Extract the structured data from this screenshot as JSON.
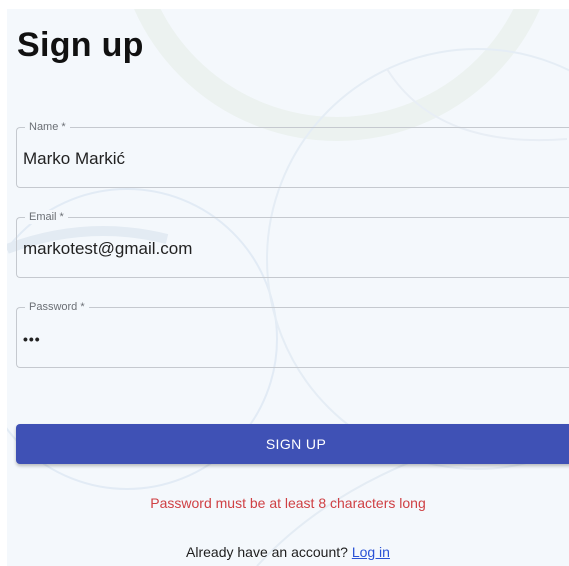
{
  "page": {
    "title": "Sign up"
  },
  "form": {
    "name": {
      "label": "Name *",
      "value": "Marko Markić"
    },
    "email": {
      "label": "Email *",
      "value": "markotest@gmail.com"
    },
    "password": {
      "label": "Password *",
      "value": "123"
    },
    "submit_label": "SIGN UP",
    "error_message": "Password must be at least 8 characters long"
  },
  "footer": {
    "prompt": "Already have an account?",
    "login_link": "Log in"
  },
  "colors": {
    "primary": "#3f51b5",
    "error": "#cf4044",
    "link": "#2a52d6",
    "background": "#f4f8fc"
  }
}
